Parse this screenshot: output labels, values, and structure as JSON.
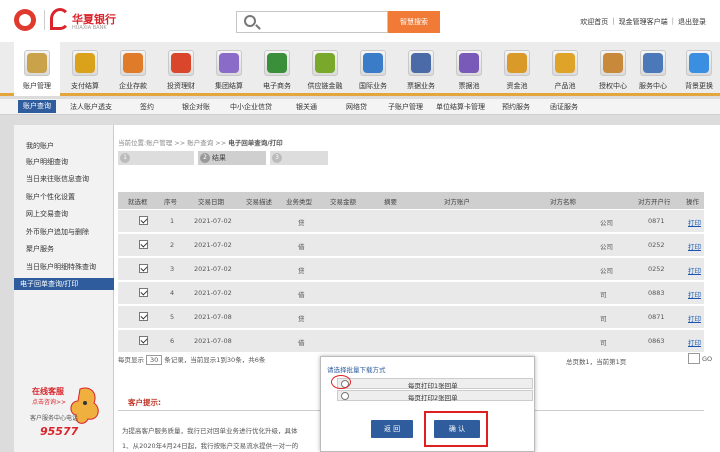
{
  "header": {
    "brand_cn": "华夏银行",
    "brand_en": "HUAXIA BANK",
    "search_placeholder": "",
    "search_button": "智慧搜索",
    "links": [
      "欢迎首页",
      "现金管理客户端",
      "退出登录"
    ]
  },
  "icon_nav": [
    {
      "label": "账户管理",
      "icon": "account-book-icon",
      "color": "#c9a24a",
      "active": true
    },
    {
      "label": "支付结算",
      "icon": "coins-icon",
      "color": "#d9a21a"
    },
    {
      "label": "企业存款",
      "icon": "deposit-icon",
      "color": "#e07b2a"
    },
    {
      "label": "投资理财",
      "icon": "investment-icon",
      "color": "#d9462b"
    },
    {
      "label": "集团结算",
      "icon": "group-settlement-icon",
      "color": "#8a6cc8"
    },
    {
      "label": "电子商务",
      "icon": "ecommerce-icon",
      "color": "#3a8f3a"
    },
    {
      "label": "供应链金融",
      "icon": "supply-chain-icon",
      "color": "#7aa82a"
    },
    {
      "label": "国际业务",
      "icon": "globe-icon",
      "color": "#3a7cc8"
    },
    {
      "label": "票据业务",
      "icon": "bill-icon",
      "color": "#4a6aa8"
    },
    {
      "label": "票据池",
      "icon": "bill-pool-icon",
      "color": "#7a5ab8"
    },
    {
      "label": "资金池",
      "icon": "fund-pool-icon",
      "color": "#d99a2a"
    },
    {
      "label": "产品池",
      "icon": "product-pool-icon",
      "color": "#e0a32a"
    },
    {
      "label": "授权中心",
      "icon": "authorization-icon",
      "color": "#c88a3a"
    },
    {
      "label": "服务中心",
      "icon": "service-center-icon",
      "color": "#4a78b8"
    },
    {
      "label": "背景更换",
      "icon": "shirt-icon",
      "color": "#3a8fe0"
    }
  ],
  "sub_nav": [
    "账户查询",
    "法人账户透支",
    "签约",
    "银企对账",
    "中小企业信贷",
    "银关通",
    "网络贷",
    "子账户管理",
    "单位结算卡管理",
    "预约服务",
    "函证服务"
  ],
  "sidebar": {
    "items": [
      "我的账户",
      "账户明细查询",
      "当日来往账信息查询",
      "账户个性化设置",
      "网上交易查询",
      "外币账户追加与删除",
      "聚户服务",
      "当日账户明细特殊查询",
      "电子回单查询/打印"
    ],
    "promo_title": "在线客服",
    "promo_sub": "点击咨询>>",
    "hotline_label": "客户服务中心电话",
    "hotline": "95577"
  },
  "breadcrumb": {
    "prefix": "当前位置:",
    "path": "账户管理 >> 账户查询 >> ",
    "current": "电子回单查询/打印"
  },
  "steps": [
    {
      "num": "1",
      "label": ""
    },
    {
      "num": "2",
      "label": "结果"
    },
    {
      "num": "3",
      "label": ""
    }
  ],
  "table": {
    "headers": [
      "就选框",
      "序号",
      "交易日期",
      "交易描述",
      "业务类型",
      "交易金额",
      "摘要",
      "对方账户",
      "对方名称",
      "对方开户行",
      "操作"
    ],
    "rows": [
      {
        "seq": "1",
        "date": "2021-07-02",
        "type": "贷",
        "name_tail": "公司",
        "bank": "0871",
        "action": "打印"
      },
      {
        "seq": "2",
        "date": "2021-07-02",
        "type": "借",
        "name_tail": "公司",
        "bank": "0252",
        "action": "打印"
      },
      {
        "seq": "3",
        "date": "2021-07-02",
        "type": "贷",
        "name_tail": "公司",
        "bank": "0252",
        "action": "打印"
      },
      {
        "seq": "4",
        "date": "2021-07-02",
        "type": "借",
        "name_tail": "司",
        "bank": "0883",
        "action": "打印"
      },
      {
        "seq": "5",
        "date": "2021-07-08",
        "type": "贷",
        "name_tail": "司",
        "bank": "0871",
        "action": "打印"
      },
      {
        "seq": "6",
        "date": "2021-07-08",
        "type": "借",
        "name_tail": "司",
        "bank": "0863",
        "action": "打印"
      }
    ]
  },
  "pager": {
    "per_page_label": "每页显示",
    "per_page_value": "30",
    "records_text": "条记录，当前显示1到30条，共6条",
    "right_text": "总页数1，当前第1页",
    "go": "GO"
  },
  "tips": {
    "title": "客户提示:",
    "line1": "为提高客户服务质量，我行已对回单业务进行优化升级，具体",
    "line2": "1、从2020年4月24日起，我行按账户交易流水提供一对一的"
  },
  "modal": {
    "title": "请选择批量下载方式",
    "option1": "每页打印1张回单",
    "option2": "每页打印2张回单",
    "back_button": "返 回",
    "confirm_button": "确 认"
  }
}
